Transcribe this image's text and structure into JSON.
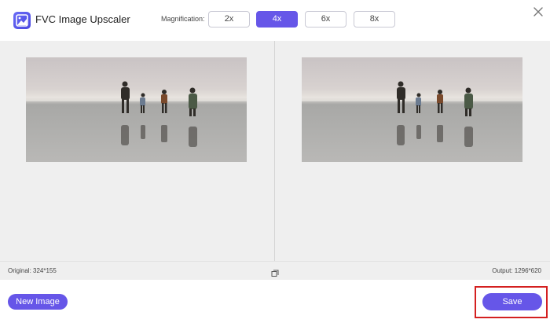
{
  "app": {
    "title": "FVC Image Upscaler",
    "logo_icon": "image-upscale-logo"
  },
  "magnification": {
    "label": "Magnification:",
    "options": [
      "2x",
      "4x",
      "6x",
      "8x"
    ],
    "selected": "4x"
  },
  "preview": {
    "original_image_alt": "Family walking on beach",
    "output_image_alt": "Family walking on beach (upscaled)"
  },
  "info": {
    "original": "Original: 324*155",
    "output": "Output: 1296*620"
  },
  "footer": {
    "new_image_label": "New Image",
    "save_label": "Save"
  },
  "colors": {
    "accent": "#6656e8",
    "highlight": "#d42020",
    "preview_bg": "#efefef"
  }
}
